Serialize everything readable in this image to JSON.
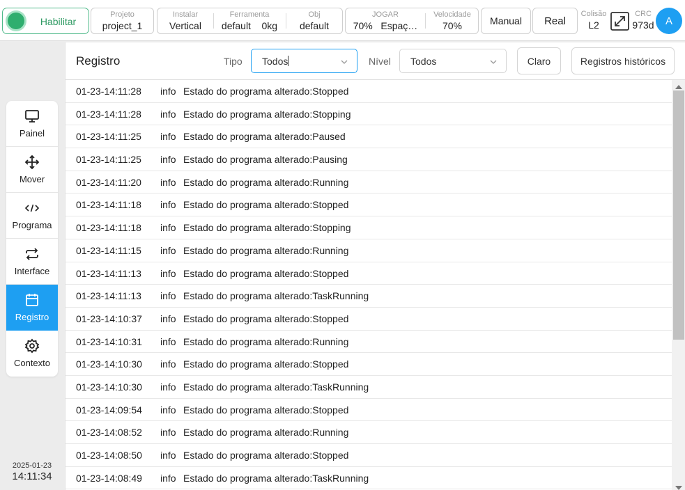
{
  "topbar": {
    "enable_label": "Habilitar",
    "project": {
      "caption": "Projeto",
      "value": "project_1"
    },
    "install": {
      "caption": "Instalar",
      "value": "Vertical"
    },
    "tool": {
      "caption": "Ferramenta",
      "value": "default",
      "load": "0kg"
    },
    "obj": {
      "caption": "Obj",
      "value": "default"
    },
    "jog": {
      "caption": "JOGAR",
      "value": "70%",
      "mode": "Espaç…"
    },
    "speed": {
      "caption": "Velocidade",
      "value": "70%"
    },
    "manual_label": "Manual",
    "real_label": "Real",
    "collision": {
      "caption": "Colisão",
      "value": "L2"
    },
    "crc": {
      "caption": "CRC",
      "value": "973d"
    },
    "avatar_letter": "A"
  },
  "sidebar": {
    "items": [
      {
        "label": "Painel",
        "icon": "monitor-icon"
      },
      {
        "label": "Mover",
        "icon": "move-arrows-icon"
      },
      {
        "label": "Programa",
        "icon": "code-icon"
      },
      {
        "label": "Interface",
        "icon": "swap-arrows-icon"
      },
      {
        "label": "Registro",
        "icon": "calendar-icon",
        "active": true
      },
      {
        "label": "Contexto",
        "icon": "gear-icon"
      }
    ],
    "date": "2025-01-23",
    "time": "14:11:34"
  },
  "main": {
    "title": "Registro",
    "type_label": "Tipo",
    "type_value": "Todos",
    "level_label": "Nível",
    "level_value": "Todos",
    "clear_label": "Claro",
    "history_label": "Registros históricos"
  },
  "logs": [
    {
      "time": "01-23-14:11:28",
      "level": "info",
      "message": "Estado do programa alterado:Stopped"
    },
    {
      "time": "01-23-14:11:28",
      "level": "info",
      "message": "Estado do programa alterado:Stopping"
    },
    {
      "time": "01-23-14:11:25",
      "level": "info",
      "message": "Estado do programa alterado:Paused"
    },
    {
      "time": "01-23-14:11:25",
      "level": "info",
      "message": "Estado do programa alterado:Pausing"
    },
    {
      "time": "01-23-14:11:20",
      "level": "info",
      "message": "Estado do programa alterado:Running"
    },
    {
      "time": "01-23-14:11:18",
      "level": "info",
      "message": "Estado do programa alterado:Stopped"
    },
    {
      "time": "01-23-14:11:18",
      "level": "info",
      "message": "Estado do programa alterado:Stopping"
    },
    {
      "time": "01-23-14:11:15",
      "level": "info",
      "message": "Estado do programa alterado:Running"
    },
    {
      "time": "01-23-14:11:13",
      "level": "info",
      "message": "Estado do programa alterado:Stopped"
    },
    {
      "time": "01-23-14:11:13",
      "level": "info",
      "message": "Estado do programa alterado:TaskRunning"
    },
    {
      "time": "01-23-14:10:37",
      "level": "info",
      "message": "Estado do programa alterado:Stopped"
    },
    {
      "time": "01-23-14:10:31",
      "level": "info",
      "message": "Estado do programa alterado:Running"
    },
    {
      "time": "01-23-14:10:30",
      "level": "info",
      "message": "Estado do programa alterado:Stopped"
    },
    {
      "time": "01-23-14:10:30",
      "level": "info",
      "message": "Estado do programa alterado:TaskRunning"
    },
    {
      "time": "01-23-14:09:54",
      "level": "info",
      "message": "Estado do programa alterado:Stopped"
    },
    {
      "time": "01-23-14:08:52",
      "level": "info",
      "message": "Estado do programa alterado:Running"
    },
    {
      "time": "01-23-14:08:50",
      "level": "info",
      "message": "Estado do programa alterado:Stopped"
    },
    {
      "time": "01-23-14:08:49",
      "level": "info",
      "message": "Estado do programa alterado:TaskRunning"
    }
  ],
  "colors": {
    "accent": "#1e9ff2",
    "enable_green": "#2fae6e"
  }
}
